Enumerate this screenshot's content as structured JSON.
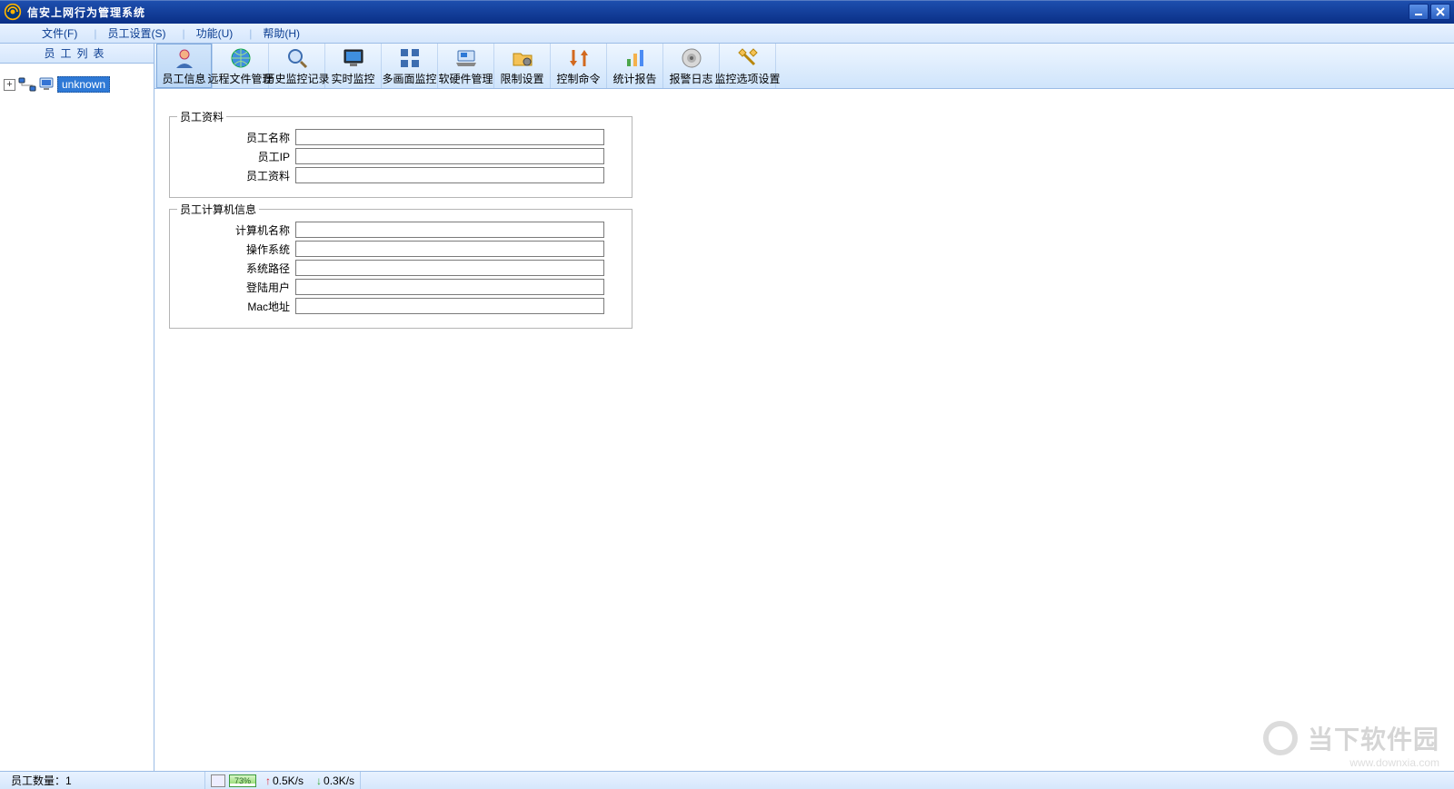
{
  "title": "信安上网行为管理系统",
  "menubar": [
    {
      "label": "文件(F)"
    },
    {
      "label": "员工设置(S)"
    },
    {
      "label": "功能(U)"
    },
    {
      "label": "帮助(H)"
    }
  ],
  "sidebar": {
    "title": "员工列表",
    "tree": {
      "expand_symbol": "+",
      "node_label": "unknown"
    }
  },
  "toolbar": [
    {
      "id": "employee-info",
      "label": "员工信息",
      "icon": "person-icon",
      "active": true
    },
    {
      "id": "remote-file",
      "label": "远程文件管理",
      "icon": "globe-icon"
    },
    {
      "id": "history",
      "label": "历史监控记录",
      "icon": "magnifier-icon"
    },
    {
      "id": "realtime",
      "label": "实时监控",
      "icon": "monitor-icon"
    },
    {
      "id": "multiscreen",
      "label": "多画面监控",
      "icon": "grid-icon"
    },
    {
      "id": "hw-sw",
      "label": "软硬件管理",
      "icon": "laptop-icon"
    },
    {
      "id": "restrict",
      "label": "限制设置",
      "icon": "folder-gear-icon"
    },
    {
      "id": "control-cmd",
      "label": "控制命令",
      "icon": "switch-icon"
    },
    {
      "id": "stats",
      "label": "统计报告",
      "icon": "barchart-icon"
    },
    {
      "id": "alarm-log",
      "label": "报警日志",
      "icon": "bell-icon"
    },
    {
      "id": "monitor-opts",
      "label": "监控选项设置",
      "icon": "wrench-icon"
    }
  ],
  "form": {
    "group1": {
      "legend": "员工资料",
      "fields": [
        {
          "id": "emp-name",
          "label": "员工名称",
          "value": ""
        },
        {
          "id": "emp-ip",
          "label": "员工IP",
          "value": ""
        },
        {
          "id": "emp-info",
          "label": "员工资料",
          "value": ""
        }
      ]
    },
    "group2": {
      "legend": "员工计算机信息",
      "fields": [
        {
          "id": "pc-name",
          "label": "计算机名称",
          "value": ""
        },
        {
          "id": "os",
          "label": "操作系统",
          "value": ""
        },
        {
          "id": "sys-path",
          "label": "系统路径",
          "value": ""
        },
        {
          "id": "login",
          "label": "登陆用户",
          "value": ""
        },
        {
          "id": "mac",
          "label": "Mac地址",
          "value": ""
        }
      ]
    }
  },
  "statusbar": {
    "employee_count_label": "员工数量：",
    "employee_count_value": "1",
    "cpu_percent": "73%",
    "net_up": "0.5K/s",
    "net_dn": "0.3K/s"
  },
  "watermark": {
    "text": "当下软件园",
    "url": "www.downxia.com"
  }
}
